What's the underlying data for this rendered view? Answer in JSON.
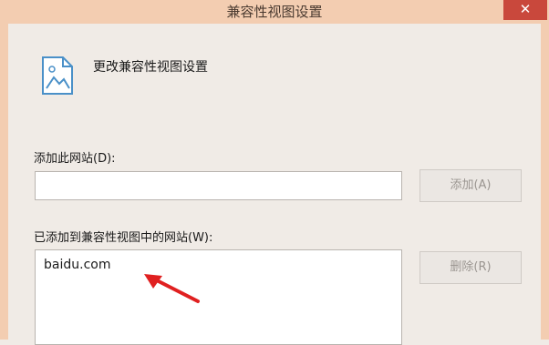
{
  "window": {
    "title": "兼容性视图设置",
    "close_symbol": "✕"
  },
  "header": {
    "icon": "document-image-icon",
    "heading": "更改兼容性视图设置"
  },
  "add_section": {
    "label": "添加此网站(D):",
    "input_value": "",
    "add_button": "添加(A)"
  },
  "list_section": {
    "label": "已添加到兼容性视图中的网站(W):",
    "items": [
      "baidu.com"
    ],
    "remove_button": "删除(R)"
  },
  "colors": {
    "titlebar": "#f3cdb1",
    "close_button": "#c9483c",
    "annotation_arrow": "#e02020"
  }
}
